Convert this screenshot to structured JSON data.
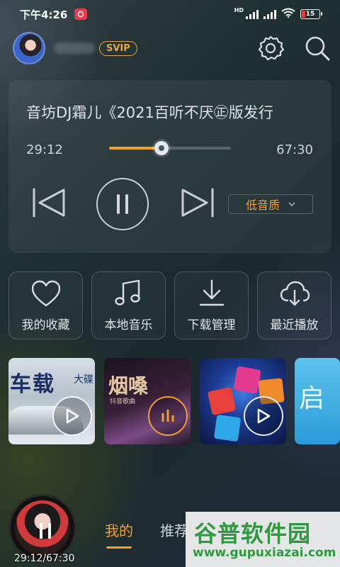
{
  "status_bar": {
    "time": "下午4:26",
    "app_badge": "app",
    "network": "HD",
    "battery": "15"
  },
  "header": {
    "vip_badge": "SVIP",
    "icons": [
      "settings-icon",
      "search-icon"
    ]
  },
  "player": {
    "song_title": "音坊DJ霜儿《2021百听不厌㊣版发行",
    "elapsed": "29:12",
    "duration": "67:30",
    "progress": 0.4326,
    "quality": "低音质",
    "icons": [
      "previous-icon",
      "pause-icon",
      "next-icon",
      "chevron-down-icon"
    ]
  },
  "quick_actions": [
    {
      "label": "我的收藏",
      "icon": "heart-icon"
    },
    {
      "label": "本地音乐",
      "icon": "music-note-icon"
    },
    {
      "label": "下载管理",
      "icon": "download-icon"
    },
    {
      "label": "最近播放",
      "icon": "cloud-icon"
    }
  ],
  "playlists": [
    {
      "title": "车载",
      "subtitle": "大碟",
      "play_icon": "play-icon"
    },
    {
      "title": "烟嗓",
      "subtitle": "抖音歌曲",
      "play_icon": "equalizer-icon"
    },
    {
      "title": "",
      "subtitle": "",
      "play_icon": "play-icon"
    },
    {
      "title": "启",
      "subtitle": "",
      "play_icon": ""
    }
  ],
  "mini_player": {
    "time": "29:12/67:30"
  },
  "tabs": [
    {
      "label": "我的",
      "active": true
    },
    {
      "label": "推荐",
      "active": false
    }
  ],
  "watermark": {
    "title": "谷普软件园",
    "url": "www.gupuxiazai.com"
  },
  "colors": {
    "accent": "#f0a030",
    "vip": "#e9a53a"
  }
}
